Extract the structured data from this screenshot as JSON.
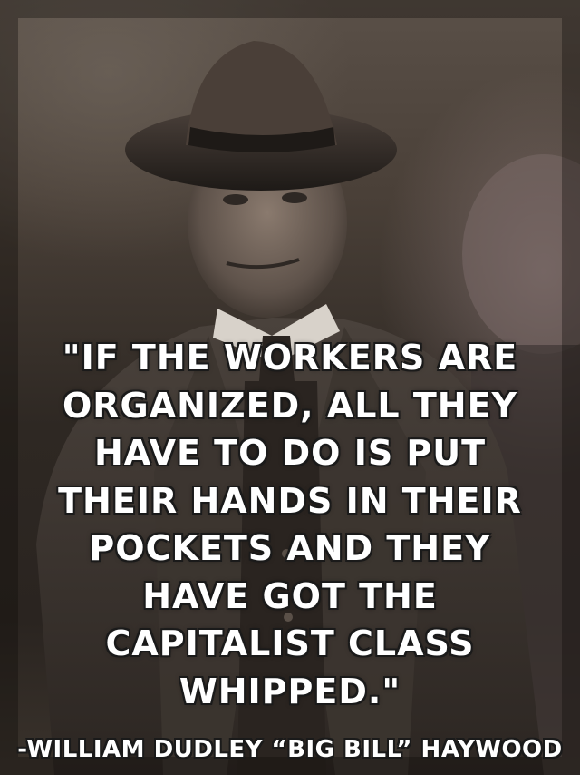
{
  "quote": {
    "lines": [
      "\"IF THE WORKERS ARE",
      "ORGANIZED, ALL THEY",
      "HAVE TO DO IS PUT",
      "THEIR HANDS IN THEIR",
      "POCKETS AND THEY",
      "HAVE GOT THE",
      "CAPITALIST CLASS",
      "WHIPPED.\""
    ],
    "attribution": "-WILLIAM DUDLEY “BIG BILL” HAYWOOD"
  },
  "colors": {
    "text": "#ffffff",
    "outline": "#1a1a1a",
    "photo_tone": "#4a4038"
  }
}
